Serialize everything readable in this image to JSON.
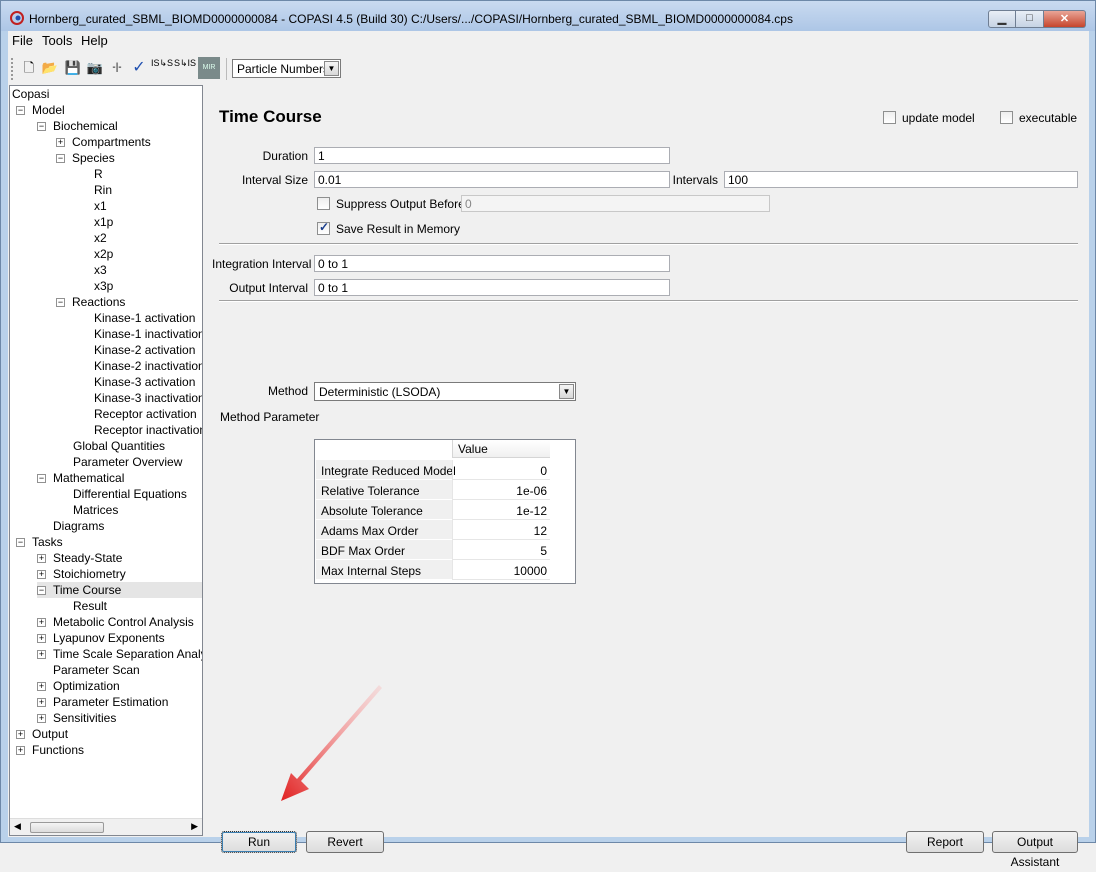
{
  "window": {
    "title": "Hornberg_curated_SBML_BIOMD0000000084 - COPASI 4.5 (Build 30) C:/Users/.../COPASI/Hornberg_curated_SBML_BIOMD0000000084.cps",
    "min_glyph": "▁",
    "max_glyph": "□",
    "close_glyph": "✕"
  },
  "menu": [
    "File",
    "Tools",
    "Help"
  ],
  "toolbar": {
    "icons": [
      "new-file-icon",
      "open-folder-icon",
      "save-icon",
      "camera-icon",
      "slider-icon",
      "check-icon",
      "is-s-icon",
      "s-is-icon",
      "miriam-icon"
    ],
    "new_glyph": "🗋",
    "open_glyph": "📂",
    "save_glyph": "💾",
    "camera_glyph": "📷",
    "slider_glyph": "-|-",
    "check_glyph": "✓",
    "iss_glyph": "IS↳S",
    "sis_glyph": "S↳IS",
    "miriam_glyph": "MIR",
    "quantity_mode": "Particle Numbers"
  },
  "tree": {
    "root": "Copasi",
    "model": "Model",
    "biochemical": "Biochemical",
    "compartments": "Compartments",
    "species": "Species",
    "species_items": [
      "R",
      "Rin",
      "x1",
      "x1p",
      "x2",
      "x2p",
      "x3",
      "x3p"
    ],
    "reactions": "Reactions",
    "reaction_items": [
      "Kinase-1 activation",
      "Kinase-1 inactivation",
      "Kinase-2 activation",
      "Kinase-2 inactivation",
      "Kinase-3 activation",
      "Kinase-3 inactivation",
      "Receptor activation",
      "Receptor inactivation"
    ],
    "global_quantities": "Global Quantities",
    "parameter_overview": "Parameter Overview",
    "mathematical": "Mathematical",
    "differential_equations": "Differential Equations",
    "matrices": "Matrices",
    "diagrams": "Diagrams",
    "tasks": "Tasks",
    "steady_state": "Steady-State",
    "stoichiometry": "Stoichiometry",
    "time_course": "Time Course",
    "result": "Result",
    "mca": "Metabolic Control Analysis",
    "lyapunov": "Lyapunov Exponents",
    "tssa": "Time Scale Separation Analysis",
    "parameter_scan": "Parameter Scan",
    "optimization": "Optimization",
    "parameter_estimation": "Parameter Estimation",
    "sensitivities": "Sensitivities",
    "output": "Output",
    "functions": "Functions"
  },
  "task": {
    "title": "Time Course",
    "update_model_label": "update model",
    "executable_label": "executable",
    "duration_label": "Duration",
    "duration": "1",
    "interval_size_label": "Interval Size",
    "interval_size": "0.01",
    "intervals_label": "Intervals",
    "intervals": "100",
    "suppress_label": "Suppress Output Before",
    "suppress_value": "0",
    "save_label": "Save Result in Memory",
    "integration_interval_label": "Integration Interval",
    "integration_interval": "0 to 1",
    "output_interval_label": "Output Interval",
    "output_interval": "0 to 1",
    "method_label": "Method",
    "method": "Deterministic (LSODA)",
    "method_param_label": "Method Parameter",
    "value_header": "Value",
    "params": [
      {
        "name": "Integrate Reduced Model",
        "value": "0"
      },
      {
        "name": "Relative Tolerance",
        "value": "1e-06"
      },
      {
        "name": "Absolute Tolerance",
        "value": "1e-12"
      },
      {
        "name": "Adams Max Order",
        "value": "12"
      },
      {
        "name": "BDF Max Order",
        "value": "5"
      },
      {
        "name": "Max Internal Steps",
        "value": "10000"
      }
    ]
  },
  "buttons": {
    "run": "Run",
    "revert": "Revert",
    "report": "Report",
    "output_assistant": "Output Assistant"
  },
  "colors": {
    "annotation_arrow": "#e02020",
    "titlebar": "#b9d1ea"
  }
}
